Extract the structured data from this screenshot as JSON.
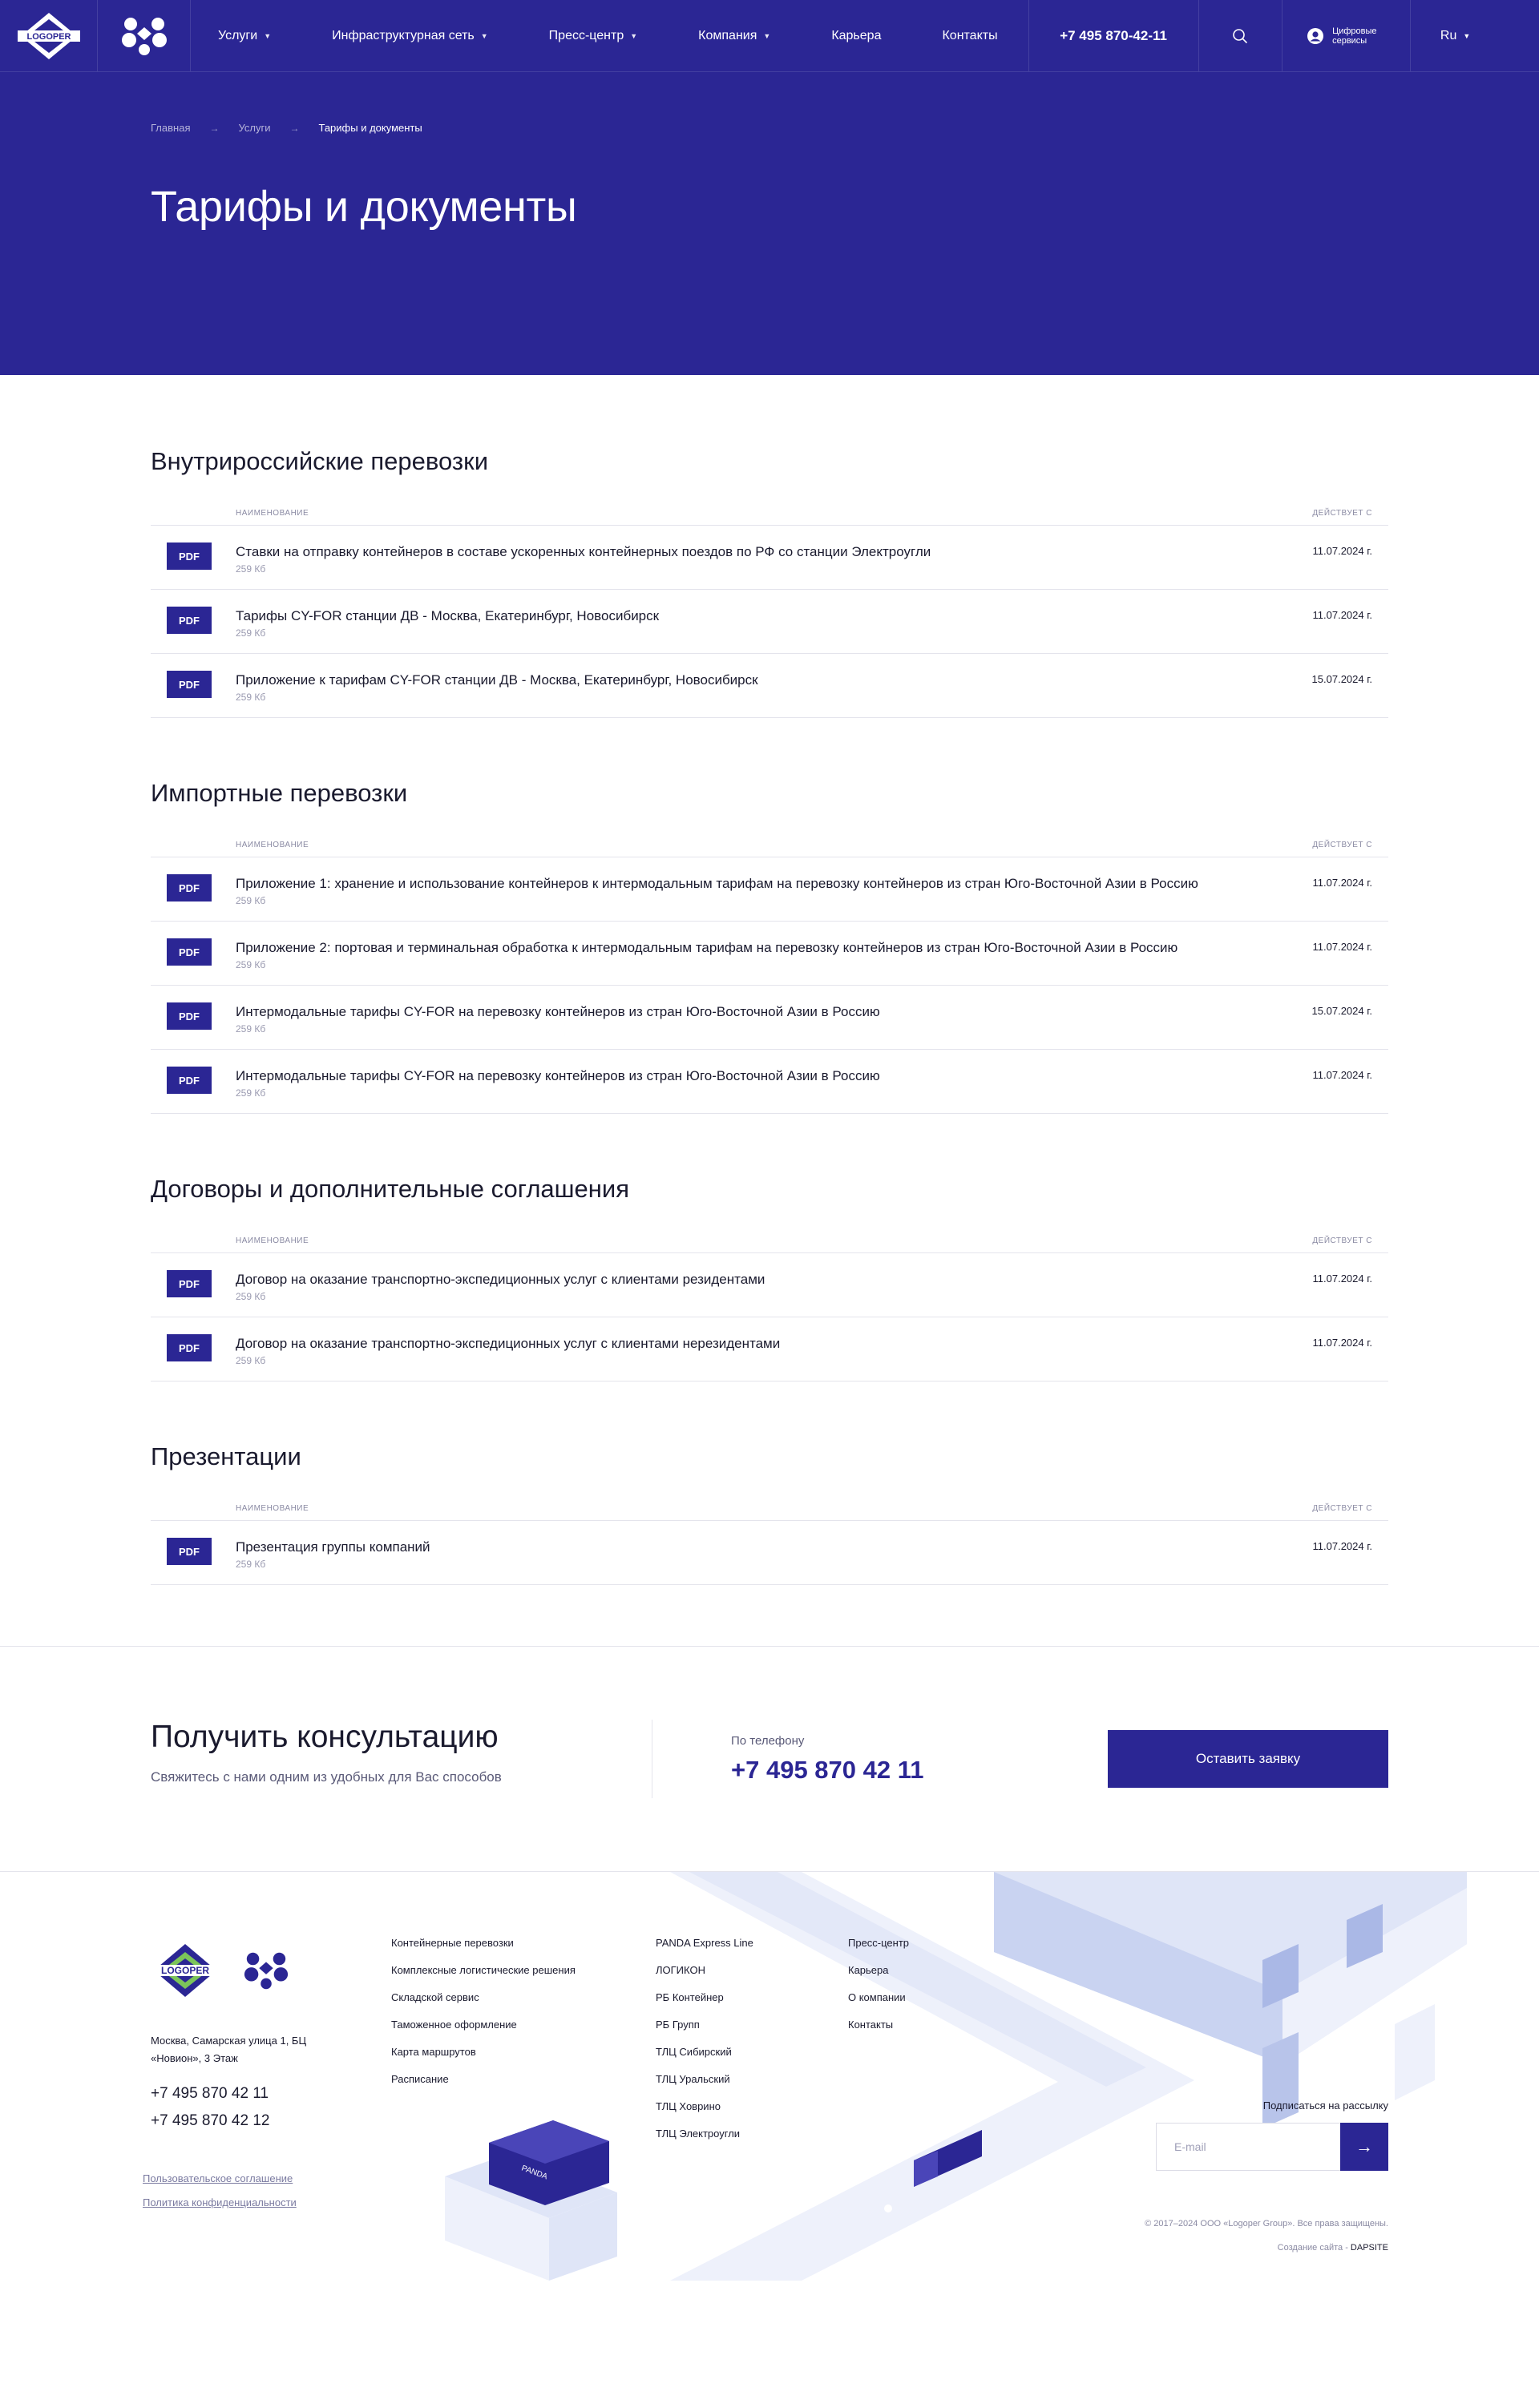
{
  "header": {
    "nav": [
      {
        "label": "Услуги",
        "dropdown": true
      },
      {
        "label": "Инфраструктурная сеть",
        "dropdown": true
      },
      {
        "label": "Пресс-центр",
        "dropdown": true
      },
      {
        "label": "Компания",
        "dropdown": true
      },
      {
        "label": "Карьера",
        "dropdown": false
      },
      {
        "label": "Контакты",
        "dropdown": false
      }
    ],
    "phone": "+7 495 870-42-11",
    "digital_services": "Цифровые сервисы",
    "lang": "Ru"
  },
  "hero": {
    "breadcrumbs": [
      "Главная",
      "Услуги",
      "Тарифы и документы"
    ],
    "title": "Тарифы и документы"
  },
  "table_head": {
    "name": "Наименование",
    "date": "Действует с"
  },
  "sections": [
    {
      "title": "Внутрироссийские перевозки",
      "docs": [
        {
          "badge": "PDF",
          "title": "Ставки на отправку контейнеров в составе ускоренных контейнерных поездов по РФ со станции Электроугли",
          "size": "259 Кб",
          "date": "11.07.2024 г."
        },
        {
          "badge": "PDF",
          "title": "Тарифы CY-FOR станции ДВ - Москва, Екатеринбург, Новосибирск",
          "size": "259 Кб",
          "date": "11.07.2024 г."
        },
        {
          "badge": "PDF",
          "title": "Приложение к тарифам CY-FOR станции ДВ - Москва, Екатеринбург, Новосибирск",
          "size": "259 Кб",
          "date": "15.07.2024 г."
        }
      ]
    },
    {
      "title": "Импортные перевозки",
      "docs": [
        {
          "badge": "PDF",
          "title": "Приложение 1: хранение и использование контейнеров к интермодальным тарифам на перевозку контейнеров из стран Юго-Восточной Азии в Россию",
          "size": "259 Кб",
          "date": "11.07.2024 г."
        },
        {
          "badge": "PDF",
          "title": "Приложение 2: портовая и терминальная обработка к интермодальным тарифам на перевозку контейнеров из стран Юго-Восточной Азии в Россию",
          "size": "259 Кб",
          "date": "11.07.2024 г."
        },
        {
          "badge": "PDF",
          "title": "Интермодальные тарифы CY-FOR на перевозку контейнеров из стран Юго-Восточной Азии в Россию",
          "size": "259 Кб",
          "date": "15.07.2024 г."
        },
        {
          "badge": "PDF",
          "title": "Интермодальные тарифы CY-FOR на перевозку контейнеров из стран Юго-Восточной Азии в Россию",
          "size": "259 Кб",
          "date": "11.07.2024 г."
        }
      ]
    },
    {
      "title": "Договоры и дополнительные соглашения",
      "docs": [
        {
          "badge": "PDF",
          "title": "Договор на оказание транспортно-экспедиционных услуг с клиентами резидентами",
          "size": "259 Кб",
          "date": "11.07.2024 г."
        },
        {
          "badge": "PDF",
          "title": "Договор на оказание транспортно-экспедиционных услуг с клиентами нерезидентами",
          "size": "259 Кб",
          "date": "11.07.2024 г."
        }
      ]
    },
    {
      "title": "Презентации",
      "docs": [
        {
          "badge": "PDF",
          "title": "Презентация группы компаний",
          "size": "259 Кб",
          "date": "11.07.2024 г."
        }
      ]
    }
  ],
  "consult": {
    "title": "Получить консультацию",
    "subtitle": "Свяжитесь с нами одним из удобных для Вас способов",
    "phone_label": "По телефону",
    "phone": "+7 495 870 42 11",
    "button": "Оставить заявку"
  },
  "footer": {
    "logo_text": "LOGOPER",
    "address": "Москва, Самарская улица 1, БЦ «Новион», 3 Этаж",
    "phones": [
      "+7 495 870 42 11",
      "+7 495 870 42 12"
    ],
    "legal": [
      "Пользовательское соглашение",
      "Политика конфиденциальности"
    ],
    "col1": [
      "Контейнерные перевозки",
      "Комплексные логистические решения",
      "Складской сервис",
      "Таможенное оформление",
      "Карта маршрутов",
      "Расписание"
    ],
    "col2": [
      "PANDA Express Line",
      "ЛОГИКОН",
      "РБ Контейнер",
      "РБ Групп",
      "ТЛЦ Сибирский",
      "ТЛЦ Уральский",
      "ТЛЦ Ховрино",
      "ТЛЦ Электроугли"
    ],
    "col3": [
      "Пресс-центр",
      "Карьера",
      "О компании",
      "Контакты"
    ],
    "subscribe_label": "Подписаться на рассылку",
    "email_placeholder": "E-mail",
    "copyright": "© 2017–2024 ООО «Logoper Group». Все права защищены.",
    "dev_label": "Создание сайта -",
    "dev_name": "DAPSITE",
    "container_text": "PANDA"
  },
  "colors": {
    "brand": "#2b2694",
    "text": "#1a1a2e",
    "muted": "#8a8aa3",
    "border": "#e4e4ec"
  }
}
